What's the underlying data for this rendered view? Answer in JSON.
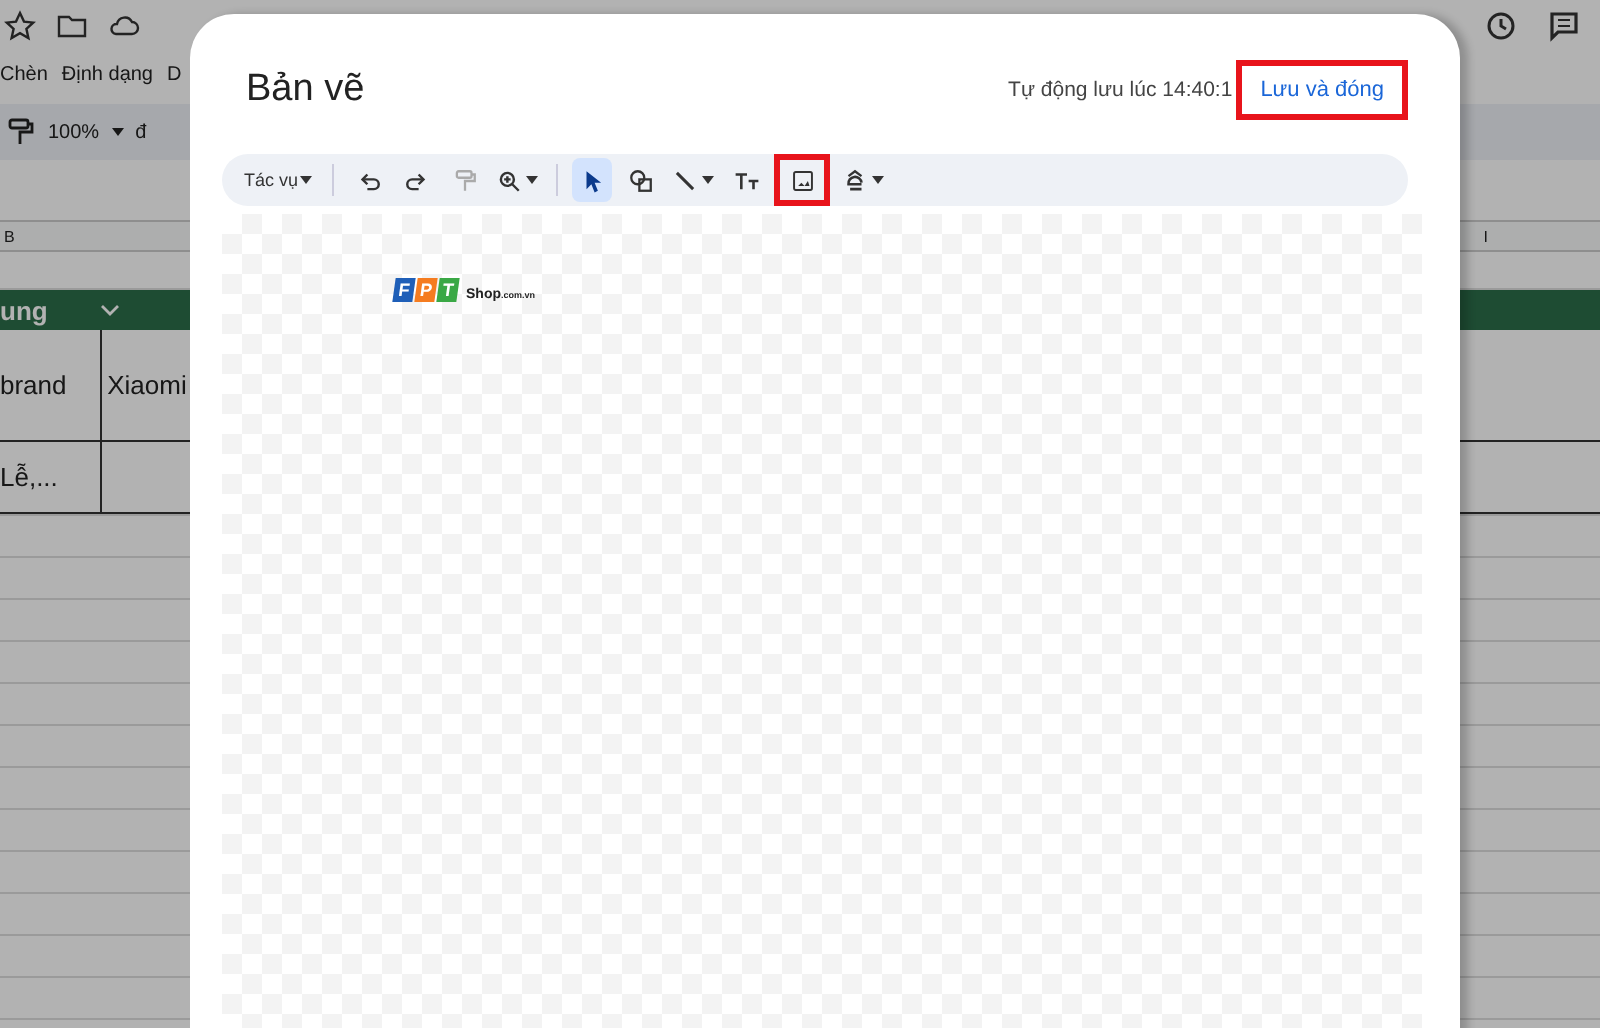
{
  "spreadsheet": {
    "menu": [
      "Chèn",
      "Định dạng",
      "D"
    ],
    "zoom": "100%",
    "currency": "đ",
    "column_headers": [
      "B",
      "I"
    ],
    "group_header": "ung",
    "cells": [
      "brand",
      "Xiaomi",
      "Lễ,..."
    ]
  },
  "dialog": {
    "title": "Bản vẽ",
    "autosave": "Tự động lưu lúc 14:40:1",
    "save_button": {
      "label": "Lưu và đóng",
      "highlighted": true
    },
    "toolbar": {
      "actions_menu": "Tác vụ",
      "groups": [
        [
          {
            "kind": "undo",
            "selected": false,
            "disabled": false,
            "highlighted": false,
            "caret": false
          },
          {
            "kind": "redo",
            "selected": false,
            "disabled": false,
            "highlighted": false,
            "caret": false
          },
          {
            "kind": "paint",
            "selected": false,
            "disabled": true,
            "highlighted": false,
            "caret": false
          },
          {
            "kind": "zoom",
            "selected": false,
            "disabled": false,
            "highlighted": false,
            "caret": true
          }
        ],
        [
          {
            "kind": "select",
            "selected": true,
            "disabled": false,
            "highlighted": false,
            "caret": false
          },
          {
            "kind": "shape",
            "selected": false,
            "disabled": false,
            "highlighted": false,
            "caret": false
          },
          {
            "kind": "line",
            "selected": false,
            "disabled": false,
            "highlighted": false,
            "caret": true
          },
          {
            "kind": "text",
            "selected": false,
            "disabled": false,
            "highlighted": false,
            "caret": false
          },
          {
            "kind": "image",
            "selected": false,
            "disabled": false,
            "highlighted": true,
            "caret": false
          },
          {
            "kind": "wordart",
            "selected": false,
            "disabled": false,
            "highlighted": false,
            "caret": true
          }
        ]
      ]
    },
    "logo": {
      "letters": [
        {
          "char": "F",
          "color": "#1f5fb8"
        },
        {
          "char": "P",
          "color": "#f57c20"
        },
        {
          "char": "T",
          "color": "#3aa845"
        }
      ],
      "word": "Shop",
      "suffix": ".com.vn"
    }
  }
}
